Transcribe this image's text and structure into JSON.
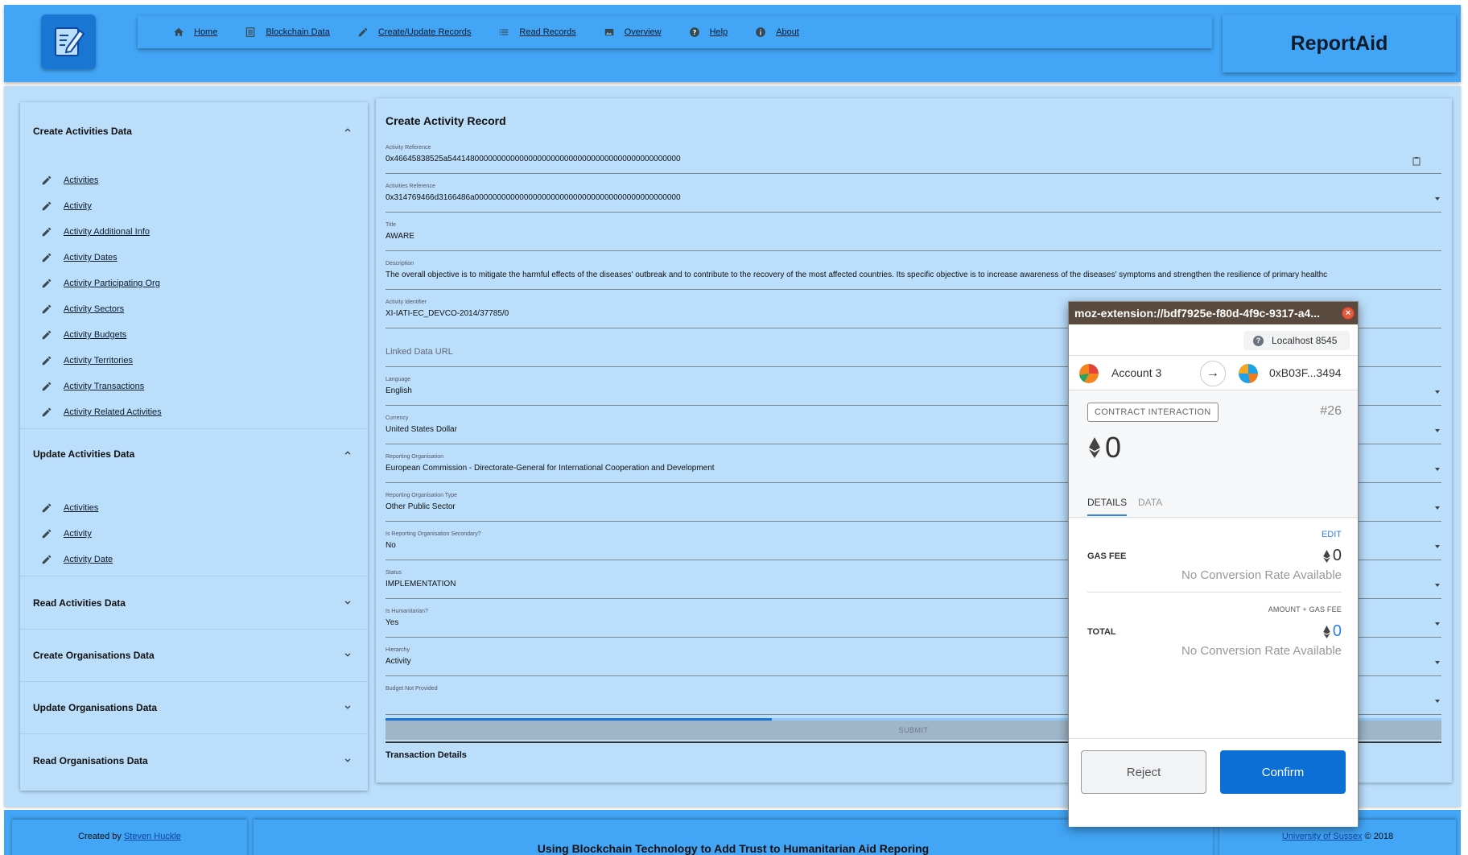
{
  "header": {
    "nav": [
      {
        "label": "Home",
        "icon": "home-icon"
      },
      {
        "label": "Blockchain Data",
        "icon": "list-box-icon"
      },
      {
        "label": "Create/Update Records",
        "icon": "pencil-icon"
      },
      {
        "label": "Read Records",
        "icon": "list-icon"
      },
      {
        "label": "Overview",
        "icon": "image-icon"
      },
      {
        "label": "Help",
        "icon": "help-circle-icon"
      },
      {
        "label": "About",
        "icon": "info-icon"
      }
    ],
    "brand": "ReportAid"
  },
  "sidebar": {
    "create_activities": {
      "title": "Create Activities Data",
      "items": [
        "Activities",
        "Activity",
        "Activity Additional Info",
        "Activity Dates",
        "Activity Participating Org",
        "Activity Sectors",
        "Activity Budgets",
        "Activity Territories",
        "Activity Transactions",
        "Activity Related Activities"
      ]
    },
    "update_activities": {
      "title": "Update Activities Data",
      "items": [
        "Activities",
        "Activity",
        "Activity Date"
      ]
    },
    "read_activities": {
      "title": "Read Activities Data"
    },
    "create_orgs": {
      "title": "Create Organisations Data"
    },
    "update_orgs": {
      "title": "Update Organisations Data"
    },
    "read_orgs": {
      "title": "Read Organisations Data"
    }
  },
  "form": {
    "title": "Create Activity Record",
    "fields": [
      {
        "label": "Activity Reference",
        "value": "0x46645838525a5441480000000000000000000000000000000000000000000000"
      },
      {
        "label": "Activities Reference",
        "value": "0x314769466d3166486a0000000000000000000000000000000000000000000000"
      },
      {
        "label": "Title",
        "value": "AWARE"
      },
      {
        "label": "Description",
        "value": "The overall objective is to mitigate the harmful effects of the diseases' outbreak and to contribute to the recovery of the most affected countries. Its specific objective is to increase awareness of the diseases' symptoms and strengthen the resilience of primary healthc"
      },
      {
        "label": "Activity Identifier",
        "value": "XI-IATI-EC_DEVCO-2014/37785/0"
      },
      {
        "placeholder": "Linked Data URL"
      },
      {
        "label": "Language",
        "value": "English"
      },
      {
        "label": "Currency",
        "value": "United States Dollar"
      },
      {
        "label": "Reporting Organisation",
        "value": "European Commission - Directorate-General for International Cooperation and Development"
      },
      {
        "label": "Reporting Organisation Type",
        "value": "Other Public Sector"
      },
      {
        "label": "Is Reporting Organisation Secondary?",
        "value": "No"
      },
      {
        "label": "Status",
        "value": "IMPLEMENTATION"
      },
      {
        "label": "Is Humanitarian?",
        "value": "Yes"
      },
      {
        "label": "Hierarchy",
        "value": "Activity"
      },
      {
        "label": "Budget Not Provided",
        "value": ""
      }
    ],
    "submit_label": "SUBMIT",
    "transaction_title": "Transaction Details"
  },
  "footer": {
    "created_by": "Created by",
    "author": "Steven Huckle",
    "tagline": "Using Blockchain Technology to Add Trust to Humanitarian Aid Reporing",
    "university": "University of Sussex",
    "copyright": "© 2018"
  },
  "metamask": {
    "window_title": "moz-extension://bdf7925e-f80d-4f9c-9317-a4...",
    "network": "Localhost 8545",
    "from_account": "Account 3",
    "to_address": "0xB03F...3494",
    "badge": "CONTRACT INTERACTION",
    "tx_number": "#26",
    "amount": "0",
    "tabs": [
      "DETAILS",
      "DATA"
    ],
    "edit_label": "EDIT",
    "gas_fee_label": "GAS FEE",
    "gas_fee_value": "0",
    "no_conversion": "No Conversion Rate Available",
    "amount_plus_gas": "AMOUNT + GAS FEE",
    "total_label": "TOTAL",
    "total_value": "0",
    "reject_label": "Reject",
    "confirm_label": "Confirm"
  }
}
